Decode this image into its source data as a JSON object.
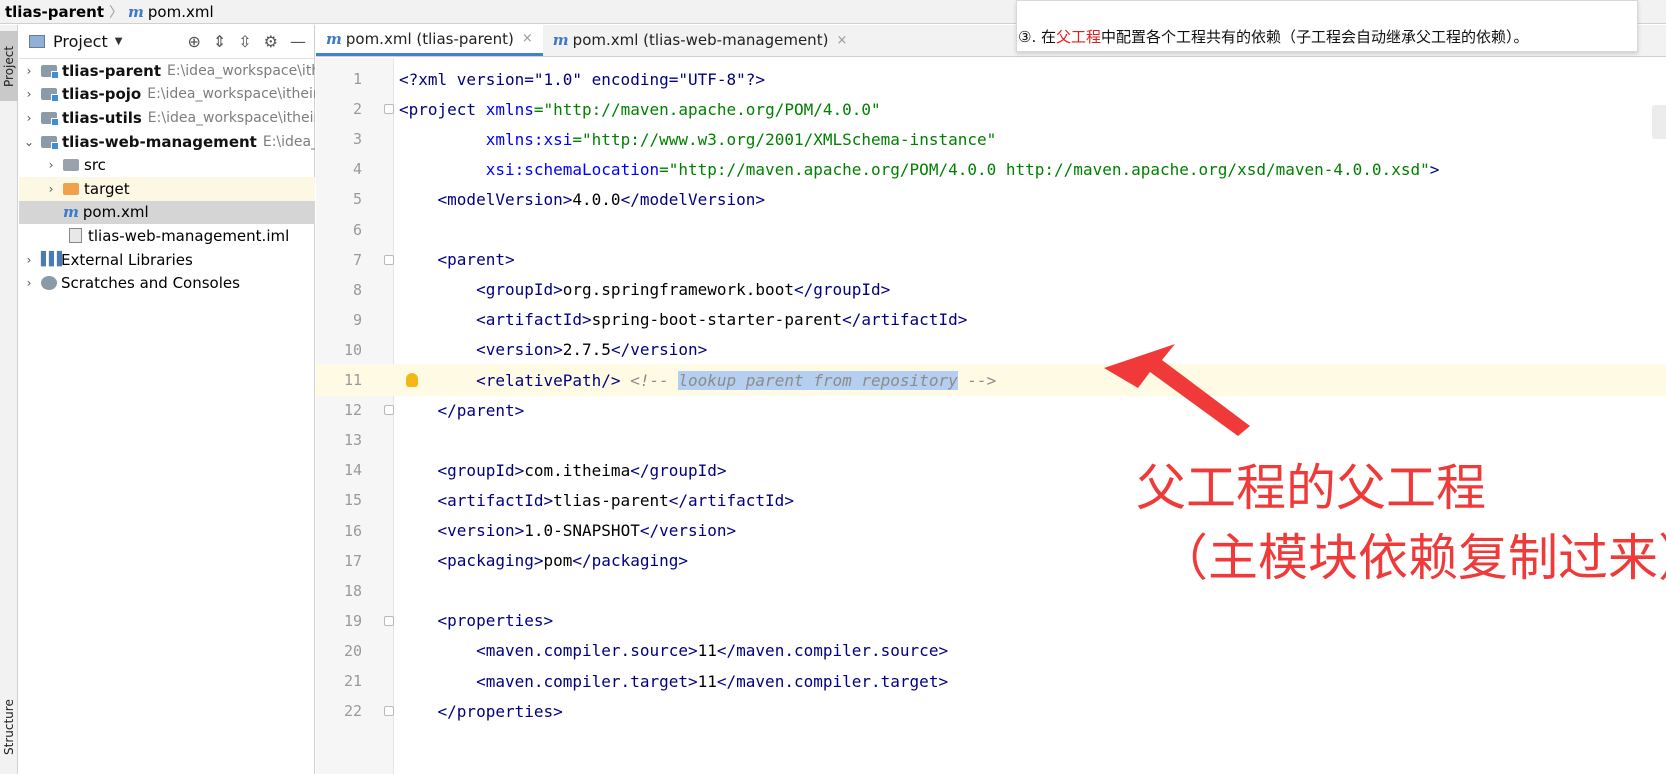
{
  "breadcrumb": {
    "project": "tlias-parent",
    "file": "pom.xml"
  },
  "toolstrip": {
    "project_tab": "Project",
    "structure_tab": "Structure"
  },
  "project_panel": {
    "title": "Project",
    "tree": [
      {
        "name": "tlias-parent",
        "path": "E:\\idea_workspace\\ithe"
      },
      {
        "name": "tlias-pojo",
        "path": "E:\\idea_workspace\\ithein"
      },
      {
        "name": "tlias-utils",
        "path": "E:\\idea_workspace\\itheim"
      },
      {
        "name": "tlias-web-management",
        "path": "E:\\idea_wo"
      },
      {
        "name": "src"
      },
      {
        "name": "target"
      },
      {
        "name": "pom.xml"
      },
      {
        "name": "tlias-web-management.iml"
      },
      {
        "name": "External Libraries"
      },
      {
        "name": "Scratches and Consoles"
      }
    ]
  },
  "tabs": [
    {
      "label": "pom.xml (tlias-parent)",
      "close": "×"
    },
    {
      "label": "pom.xml (tlias-web-management)",
      "close": "×"
    }
  ],
  "note": {
    "prefix": "③. 在",
    "highlight": "父工程",
    "suffix": "中配置各个工程共有的依赖（子工程会自动继承父工程的依赖）。"
  },
  "code_lines": [
    {
      "n": "1",
      "pre": "",
      "t1": "<?xml version=\"1.0\" encoding=\"UTF-8\"?>"
    },
    {
      "n": "2",
      "pre": "",
      "t1": "<project ",
      "a1": "xmlns",
      "v1": "=\"http://maven.apache.org/POM/4.0.0\""
    },
    {
      "n": "3",
      "pre": "         ",
      "a1": "xmlns:xsi",
      "v1": "=\"http://www.w3.org/2001/XMLSchema-instance\""
    },
    {
      "n": "4",
      "pre": "         ",
      "a1": "xsi:schemaLocation",
      "v1": "=\"http://maven.apache.org/POM/4.0.0 http://maven.apache.org/xsd/maven-4.0.0.xsd\"",
      "t2": ">"
    },
    {
      "n": "5",
      "pre": "    ",
      "t1": "<modelVersion>",
      "p": "4.0.0",
      "t2": "</modelVersion>"
    },
    {
      "n": "6",
      "pre": ""
    },
    {
      "n": "7",
      "pre": "    ",
      "t1": "<parent>"
    },
    {
      "n": "8",
      "pre": "        ",
      "t1": "<groupId>",
      "p": "org.springframework.boot",
      "t2": "</groupId>"
    },
    {
      "n": "9",
      "pre": "        ",
      "t1": "<artifactId>",
      "p": "spring-boot-starter-parent",
      "t2": "</artifactId>"
    },
    {
      "n": "10",
      "pre": "        ",
      "t1": "<version>",
      "p": "2.7.5",
      "t2": "</version>"
    },
    {
      "n": "11",
      "pre": "        ",
      "t1": "<relativePath/> ",
      "c1": "<!-- ",
      "sel": "lookup parent from repository",
      "c2": " -->"
    },
    {
      "n": "12",
      "pre": "    ",
      "t1": "</parent>"
    },
    {
      "n": "13",
      "pre": ""
    },
    {
      "n": "14",
      "pre": "    ",
      "t1": "<groupId>",
      "p": "com.itheima",
      "t2": "</groupId>"
    },
    {
      "n": "15",
      "pre": "    ",
      "t1": "<artifactId>",
      "p": "tlias-parent",
      "t2": "</artifactId>"
    },
    {
      "n": "16",
      "pre": "    ",
      "t1": "<version>",
      "p": "1.0-SNAPSHOT",
      "t2": "</version>"
    },
    {
      "n": "17",
      "pre": "    ",
      "t1": "<packaging>",
      "p": "pom",
      "t2": "</packaging>"
    },
    {
      "n": "18",
      "pre": ""
    },
    {
      "n": "19",
      "pre": "    ",
      "t1": "<properties>"
    },
    {
      "n": "20",
      "pre": "        ",
      "t1": "<maven.compiler.source>",
      "p": "11",
      "t2": "</maven.compiler.source>"
    },
    {
      "n": "21",
      "pre": "        ",
      "t1": "<maven.compiler.target>",
      "p": "11",
      "t2": "</maven.compiler.target>"
    },
    {
      "n": "22",
      "pre": "    ",
      "t1": "</properties>"
    }
  ],
  "annotation": {
    "line1": "父工程的父工程",
    "line2": "（主模块依赖复制过来）"
  },
  "colors": {
    "accent": "#4083c9",
    "annotation": "#f03a3a",
    "selection": "#b4cff0",
    "current_line": "#fffae3"
  }
}
